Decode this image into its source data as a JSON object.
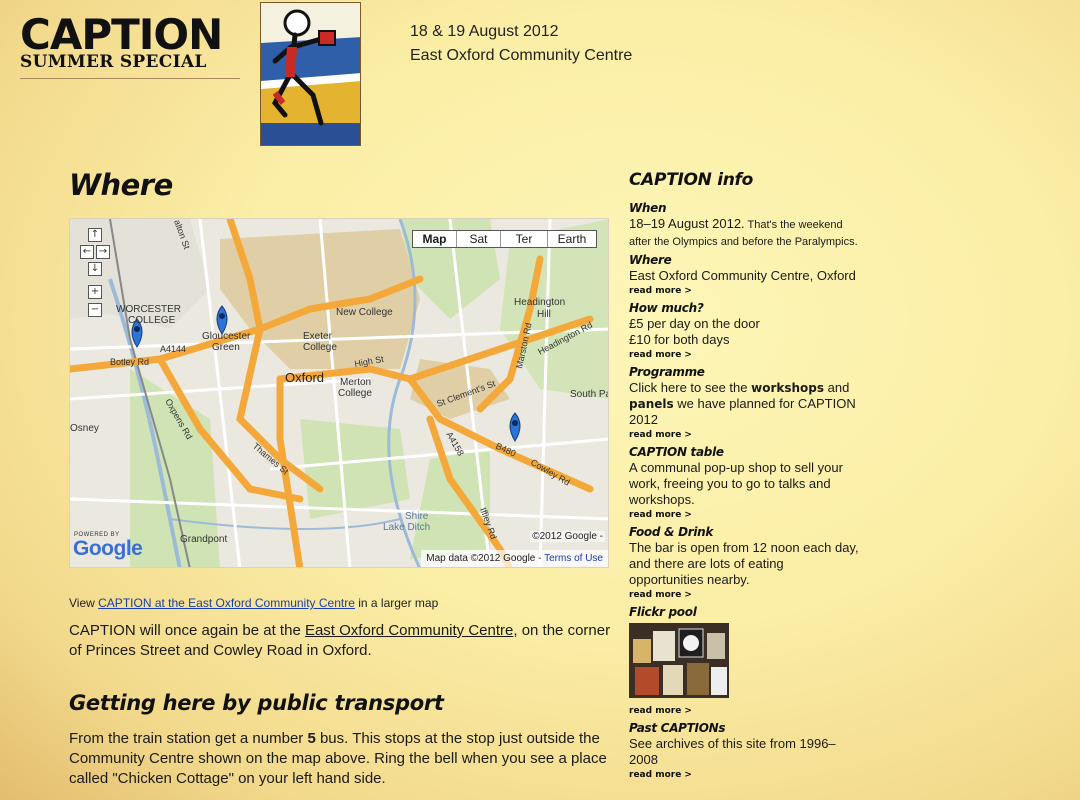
{
  "header": {
    "logo_main": "CAPTION",
    "logo_sub": "SUMMER SPECIAL",
    "date": "18 & 19 August 2012",
    "venue": "East Oxford Community Centre"
  },
  "main": {
    "title": "Where",
    "map": {
      "type_buttons": [
        "Map",
        "Sat",
        "Ter",
        "Earth"
      ],
      "active_type": "Map",
      "labels": {
        "worcester": "WORCESTER",
        "college": "COLLEGE",
        "gloucester": "Gloucester",
        "green": "Green",
        "new_college": "New College",
        "exeter": "Exeter",
        "exeter_college": "College",
        "oxford": "Oxford",
        "merton": "Merton",
        "merton_college": "College",
        "high_st": "High St",
        "headington": "Headington",
        "hill": "Hill",
        "marston_rd": "Marston Rd",
        "headington_rd": "Headington Rd",
        "south_pa": "South Pa",
        "botley_rd": "Botley Rd",
        "a4144": "A4144",
        "st_clements": "St Clement's St",
        "a4158": "A4158",
        "b480": "B480",
        "cowley_rd": "Cowley Rd",
        "osney": "Osney",
        "oxpens_rd": "Oxpens Rd",
        "thames_st": "Thames St",
        "shire": "Shire",
        "lake_ditch": "Lake Ditch",
        "iffley_rd": "Iffley Rd",
        "grandpont": "Grandpont",
        "walton_st": "alton St"
      },
      "powered_by": "POWERED BY",
      "google": "Google",
      "copyright": "©2012 Google -",
      "map_data": "Map data ©2012 Google -",
      "terms": "Terms of Use"
    },
    "view_prefix": "View ",
    "view_link": "CAPTION at the East Oxford Community Centre",
    "view_suffix": " in a larger map",
    "para1_prefix": "CAPTION will once again be at the ",
    "para1_link": "East Oxford Community Centre",
    "para1_suffix": ", on the corner of Princes Street and Cowley Road in Oxford.",
    "transport_heading": "Getting here by public transport",
    "para2_a": "From the train station get a number ",
    "para2_bus": "5",
    "para2_b": " bus. This stops at the stop just outside the Community Centre shown on the map above. Ring the bell when you see a place called \"Chicken Cottage\" on your left hand side."
  },
  "sidebar": {
    "title": "CAPTION info",
    "read_more": "read more >",
    "when": {
      "title": "When",
      "body": "18–19 August 2012.",
      "small": " That's the weekend after the Olympics and before the Paralympics."
    },
    "where": {
      "title": "Where",
      "body": "East Oxford Community Centre, Oxford"
    },
    "how_much": {
      "title": "How much?",
      "line1": "£5 per day on the door",
      "line2": "£10 for both days"
    },
    "programme": {
      "title": "Programme",
      "a": "Click here to see the ",
      "workshops": "workshops",
      "b": " and ",
      "panels": "panels",
      "c": " we have planned for CAPTION 2012"
    },
    "table": {
      "title": "CAPTION table",
      "body": "A communal pop-up shop to sell your work, freeing you to go to talks and workshops."
    },
    "food": {
      "title": "Food & Drink",
      "body": "The bar is open from 12 noon each day, and there are lots of eating opportunities nearby."
    },
    "flickr": {
      "title": "Flickr pool"
    },
    "past": {
      "title": "Past CAPTIONs",
      "body": "See archives of this site from 1996–2008"
    }
  },
  "colors": {
    "background": "#fbeea6",
    "link": "#1a3ea8",
    "road_major": "#f5a83a",
    "marker": "#2c74d8"
  }
}
